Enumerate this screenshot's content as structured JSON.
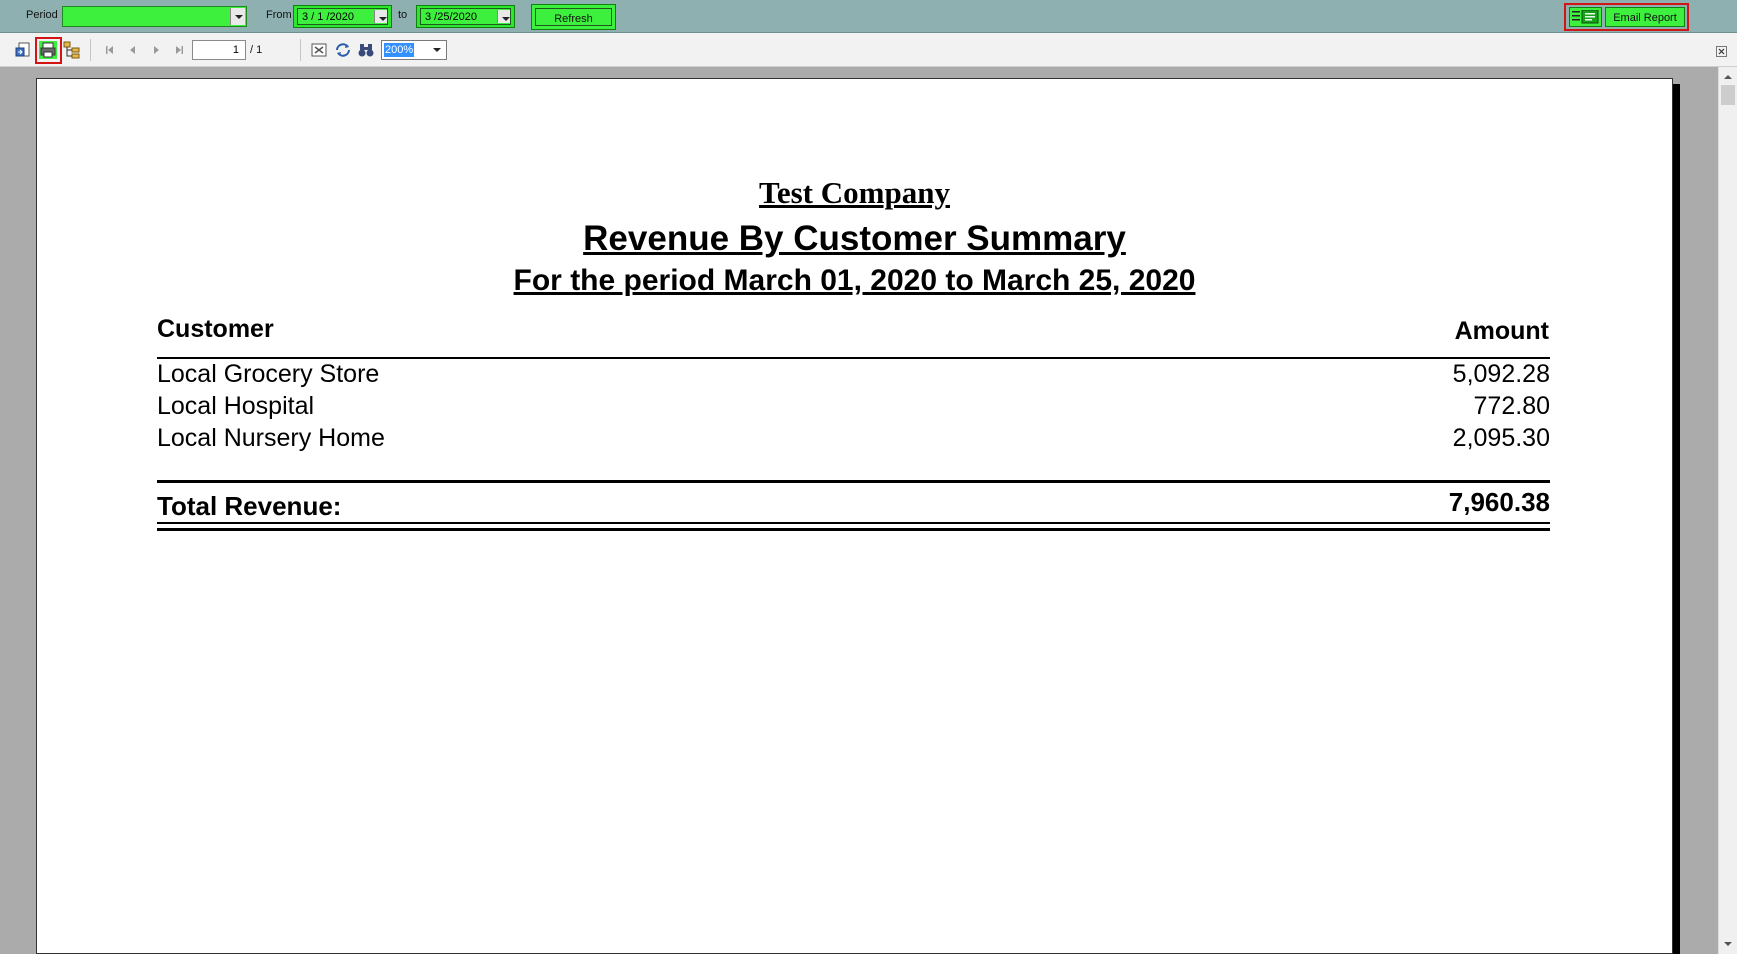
{
  "filter_bar": {
    "period_label": "Period",
    "period_value": "",
    "from_label": "From",
    "from_value": "3 / 1 /2020",
    "to_label": "to",
    "to_value": "3 /25/2020",
    "refresh_label": "Refresh",
    "email_label": "Email Report"
  },
  "viewer_toolbar": {
    "page_number": "1",
    "page_total": "/ 1",
    "zoom_value": "200%"
  },
  "report": {
    "company": "Test Company",
    "title": "Revenue By Customer Summary",
    "period": "For the period March 01, 2020 to March 25, 2020",
    "col_customer": "Customer",
    "col_amount": "Amount",
    "rows": [
      {
        "customer": "Local Grocery Store",
        "amount": "5,092.28"
      },
      {
        "customer": "Local Hospital",
        "amount": "772.80"
      },
      {
        "customer": "Local Nursery Home",
        "amount": "2,095.30"
      }
    ],
    "total_label": "Total Revenue:",
    "total_value": "7,960.38"
  },
  "colors": {
    "accent_green": "#3df03d",
    "highlight_red": "#d21414",
    "bar_teal": "#8fb0b0"
  }
}
